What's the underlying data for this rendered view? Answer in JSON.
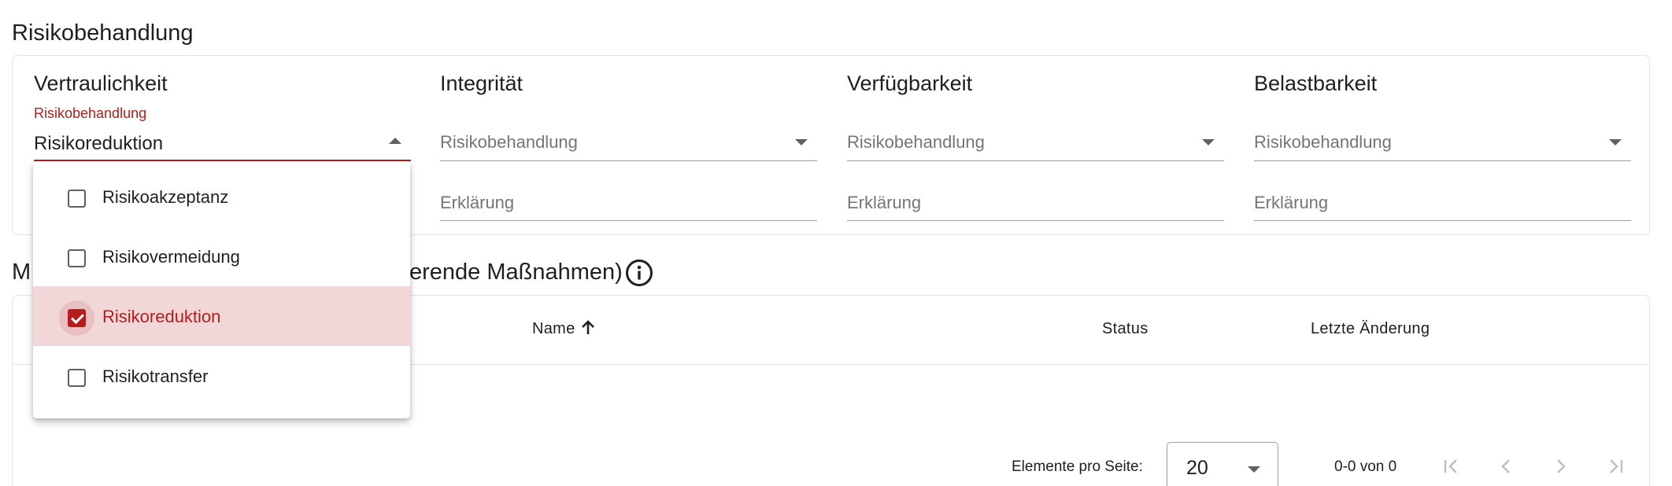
{
  "section1": {
    "title": "Risikobehandlung"
  },
  "columns": [
    {
      "title": "Vertraulichkeit",
      "float_label": "Risikobehandlung",
      "value": "Risikoreduktion",
      "explanation_placeholder": "Erklärung"
    },
    {
      "title": "Integrität",
      "placeholder": "Risikobehandlung",
      "explanation_placeholder": "Erklärung"
    },
    {
      "title": "Verfügbarkeit",
      "placeholder": "Risikobehandlung",
      "explanation_placeholder": "Erklärung"
    },
    {
      "title": "Belastbarkeit",
      "placeholder": "Risikobehandlung",
      "explanation_placeholder": "Erklärung"
    }
  ],
  "dropdown": {
    "options": [
      {
        "label": "Risikoakzeptanz",
        "checked": false
      },
      {
        "label": "Risikovermeidung",
        "checked": false
      },
      {
        "label": "Risikoreduktion",
        "checked": true
      },
      {
        "label": "Risikotransfer",
        "checked": false
      }
    ]
  },
  "section2": {
    "title_start": "M",
    "title_end": "erende Maßnahmen)",
    "info_icon": "info-circle-icon"
  },
  "table": {
    "headers": {
      "name": "Name",
      "status": "Status",
      "last_change": "Letzte Änderung"
    },
    "sort_icon": "arrow-up-icon"
  },
  "pagination": {
    "items_per_page_label": "Elemente pro Seite:",
    "page_size": "20",
    "range": "0-0 von 0"
  },
  "colors": {
    "accent": "#b71c1c",
    "selected_bg": "#f2d7d9"
  }
}
